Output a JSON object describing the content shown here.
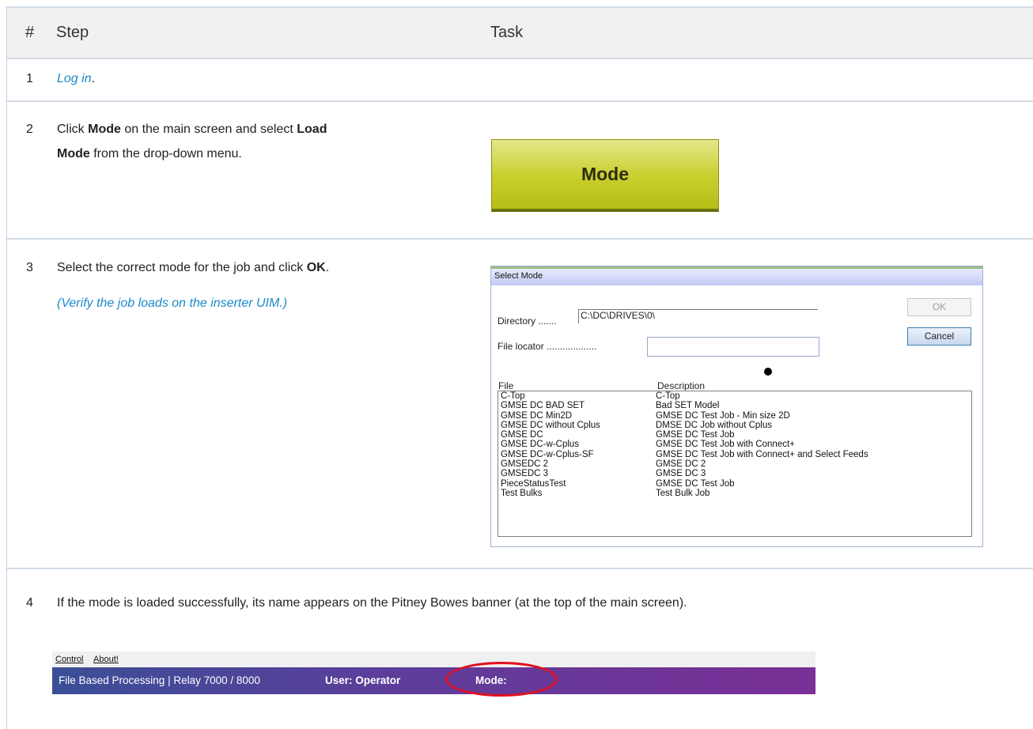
{
  "table": {
    "headers": {
      "num": "#",
      "step": "Step",
      "task": "Task"
    },
    "rows": [
      {
        "num": "1",
        "link": "Log in",
        "suffix": "."
      },
      {
        "num": "2",
        "pre": "Click ",
        "b1": "Mode",
        "mid1": " on the main screen and select ",
        "b2": "Load",
        "b3": "Mode",
        "post": " from the drop-down menu."
      },
      {
        "num": "3",
        "pre": "Select the correct mode for the job and click ",
        "b1": "OK",
        "post": ".",
        "note": "(Verify the job loads on the inserter UIM.)"
      },
      {
        "num": "4",
        "text": "If the mode is loaded successfully, its name appears on the Pitney Bowes banner (at the top of the main screen)."
      }
    ]
  },
  "mode_button": {
    "label": "Mode"
  },
  "dialog": {
    "title": "Select Mode",
    "directory_label": "Directory .......",
    "directory_value": "C:\\DC\\DRIVES\\0\\",
    "file_locator_label": "File locator ...................",
    "file_locator_value": "",
    "ok_label": "OK",
    "cancel_label": "Cancel",
    "col_file": "File",
    "col_description": "Description",
    "files": [
      {
        "file": "C-Top",
        "description": "C-Top"
      },
      {
        "file": "GMSE DC BAD SET",
        "description": "Bad SET Model"
      },
      {
        "file": "GMSE DC Min2D",
        "description": "GMSE DC Test Job - Min size 2D"
      },
      {
        "file": "GMSE DC without Cplus",
        "description": "DMSE DC Job without Cplus"
      },
      {
        "file": "GMSE DC",
        "description": "GMSE DC Test Job"
      },
      {
        "file": "GMSE DC-w-Cplus",
        "description": "GMSE DC Test Job with Connect+"
      },
      {
        "file": "GMSE DC-w-Cplus-SF",
        "description": "GMSE DC Test Job with Connect+ and Select Feeds"
      },
      {
        "file": "GMSEDC 2",
        "description": "GMSE DC 2"
      },
      {
        "file": "GMSEDC 3",
        "description": "GMSE DC 3"
      },
      {
        "file": "PieceStatusTest",
        "description": "GMSE DC Test Job"
      },
      {
        "file": "Test Bulks",
        "description": "Test Bulk Job"
      }
    ]
  },
  "banner": {
    "menu": [
      "Control",
      "About!"
    ],
    "app_title": "File Based Processing | Relay 7000 / 8000",
    "user": "User: Operator",
    "mode": "Mode:"
  },
  "colors": {
    "link": "#1a8acb",
    "banner_start": "#3b4e98",
    "banner_end": "#7a2f96",
    "mode_button": "#c8ce2a",
    "highlight_ellipse": "#e01020"
  }
}
